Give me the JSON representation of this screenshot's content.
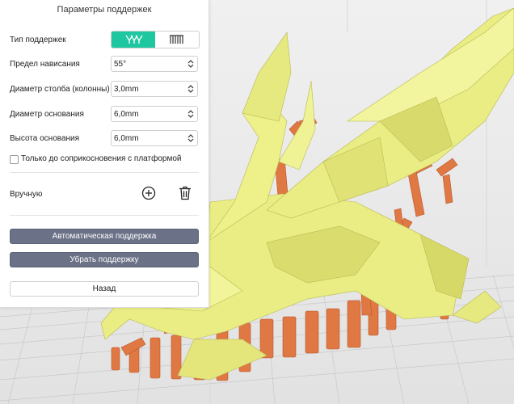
{
  "panel": {
    "title": "Параметры поддержек",
    "support_type": {
      "label": "Тип поддержек",
      "options": [
        "tree-support-icon",
        "grid-support-icon"
      ],
      "active_index": 0
    },
    "overhang": {
      "label": "Предел нависания",
      "value": "55°"
    },
    "pillar_diameter": {
      "label": "Диаметр столба (колонны)",
      "value": "3,0mm"
    },
    "base_diameter": {
      "label": "Диаметр основания",
      "value": "6,0mm"
    },
    "base_height": {
      "label": "Высота основания",
      "value": "6,0mm"
    },
    "platform_only": {
      "label": "Только до соприкосновения с платформой",
      "checked": false
    },
    "manual": {
      "label": "Вручную"
    },
    "auto_button": "Автоматическая поддержка",
    "remove_button": "Убрать поддержку",
    "back_button": "Назад"
  },
  "colors": {
    "accent": "#1fc7a0",
    "dark_button": "#6b7186",
    "model": "#eef08a",
    "supports": "#e07844"
  }
}
